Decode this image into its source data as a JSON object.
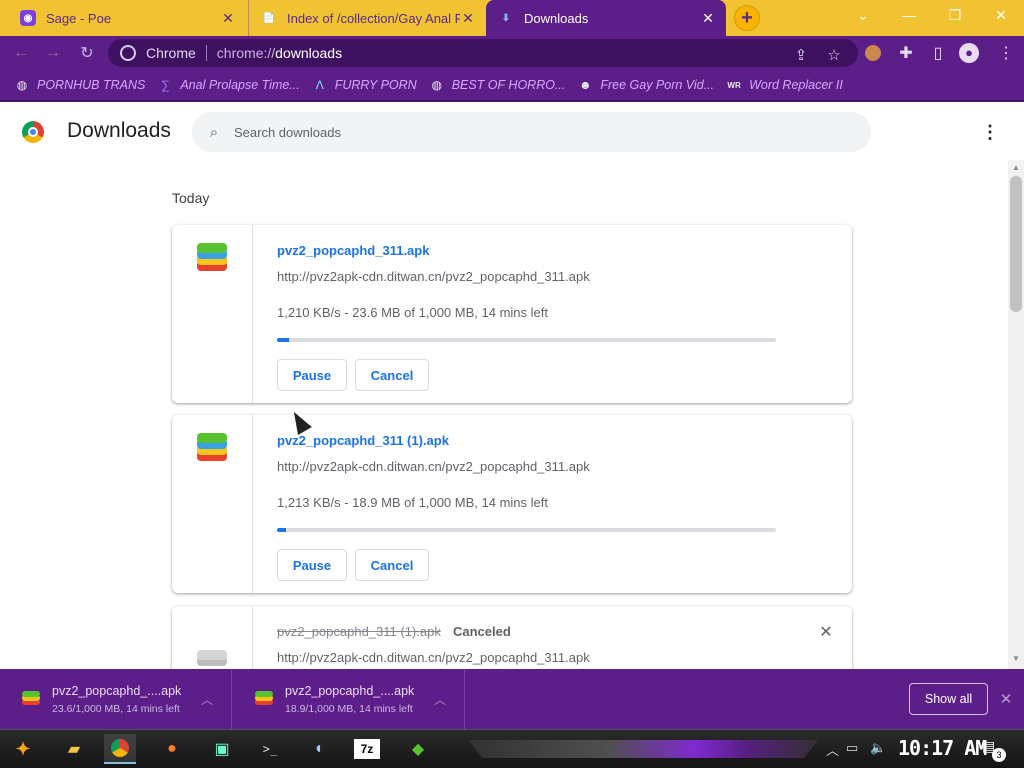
{
  "tabs": [
    {
      "title": "Sage - Poe",
      "icon": "poe-icon"
    },
    {
      "title": "Index of /collection/Gay Anal P",
      "icon": "site-icon"
    },
    {
      "title": "Downloads",
      "icon": "download-icon",
      "active": true
    }
  ],
  "toolbar": {
    "chip_label": "Chrome",
    "url_scheme": "chrome://",
    "url_host": "downloads"
  },
  "bookmarks": [
    {
      "label": "PORNHUB TRANS",
      "icon": "globe-icon"
    },
    {
      "label": "Anal Prolapse Time...",
      "icon": "bracket-icon"
    },
    {
      "label": "FURRY PORN",
      "icon": "lambda-icon"
    },
    {
      "label": "BEST OF HORRO...",
      "icon": "globe-icon"
    },
    {
      "label": "Free Gay Porn Vid...",
      "icon": "alien-icon"
    },
    {
      "label": "Word Replacer II",
      "icon": "wr-icon"
    }
  ],
  "page": {
    "title": "Downloads",
    "search_placeholder": "Search downloads",
    "date_heading": "Today"
  },
  "downloads": [
    {
      "filename": "pvz2_popcaphd_311.apk",
      "url": "http://pvz2apk-cdn.ditwan.cn/pvz2_popcaphd_311.apk",
      "status": "1,210 KB/s - 23.6 MB of 1,000 MB, 14 mins left",
      "progress": 0.0236,
      "pause_label": "Pause",
      "cancel_label": "Cancel"
    },
    {
      "filename": "pvz2_popcaphd_311 (1).apk",
      "url": "http://pvz2apk-cdn.ditwan.cn/pvz2_popcaphd_311.apk",
      "status": "1,213 KB/s - 18.9 MB of 1,000 MB, 14 mins left",
      "progress": 0.0189,
      "pause_label": "Pause",
      "cancel_label": "Cancel"
    },
    {
      "filename": "pvz2_popcaphd_311 (1).apk",
      "url": "http://pvz2apk-cdn.ditwan.cn/pvz2_popcaphd_311.apk",
      "state_label": "Canceled"
    }
  ],
  "shelf": {
    "items": [
      {
        "name": "pvz2_popcaphd_....apk",
        "status": "23.6/1,000 MB, 14 mins left"
      },
      {
        "name": "pvz2_popcaphd_....apk",
        "status": "18.9/1,000 MB, 14 mins left"
      }
    ],
    "show_all_label": "Show all"
  },
  "taskbar": {
    "clock": "10:17 AM",
    "notification_count": "3"
  },
  "colors": {
    "tab_strip": "#f1c232",
    "theme_purple": "#5c1f8a",
    "link_blue": "#1a73e8"
  }
}
